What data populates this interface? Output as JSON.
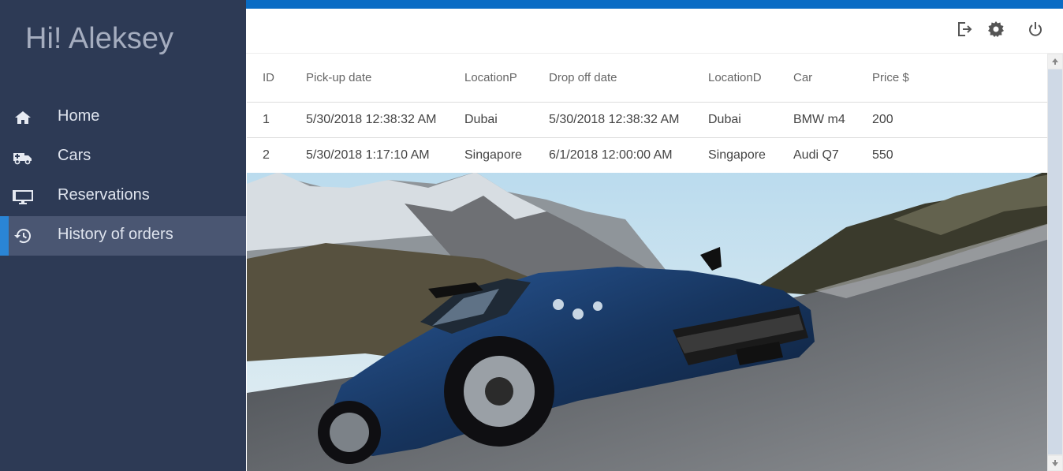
{
  "sidebar": {
    "greeting": "Hi! Aleksey",
    "items": [
      {
        "label": "Home",
        "icon": "home-icon"
      },
      {
        "label": "Cars",
        "icon": "truck-icon"
      },
      {
        "label": "Reservations",
        "icon": "monitor-icon"
      },
      {
        "label": "History of orders",
        "icon": "history-icon",
        "active": true
      }
    ]
  },
  "header": {
    "icons": [
      "logout-icon",
      "gear-icon",
      "power-icon"
    ]
  },
  "table": {
    "columns": [
      "ID",
      "Pick-up date",
      "LocationP",
      "Drop off date",
      "LocationD",
      "Car",
      "Price $"
    ],
    "rows": [
      [
        "1",
        "5/30/2018 12:38:32 AM",
        "Dubai",
        "5/30/2018 12:38:32 AM",
        "Dubai",
        "BMW m4",
        "200"
      ],
      [
        "2",
        "5/30/2018 1:17:10 AM",
        "Singapore",
        "6/1/2018 12:00:00 AM",
        "Singapore",
        "Audi Q7",
        "550"
      ]
    ]
  },
  "colors": {
    "sidebar_bg": "#2d3a55",
    "active_item_bg": "#4a5672",
    "accent": "#2a85d6",
    "topbar": "#0a6cc4"
  },
  "background": {
    "scene": "sports-car-on-mountain-road"
  }
}
